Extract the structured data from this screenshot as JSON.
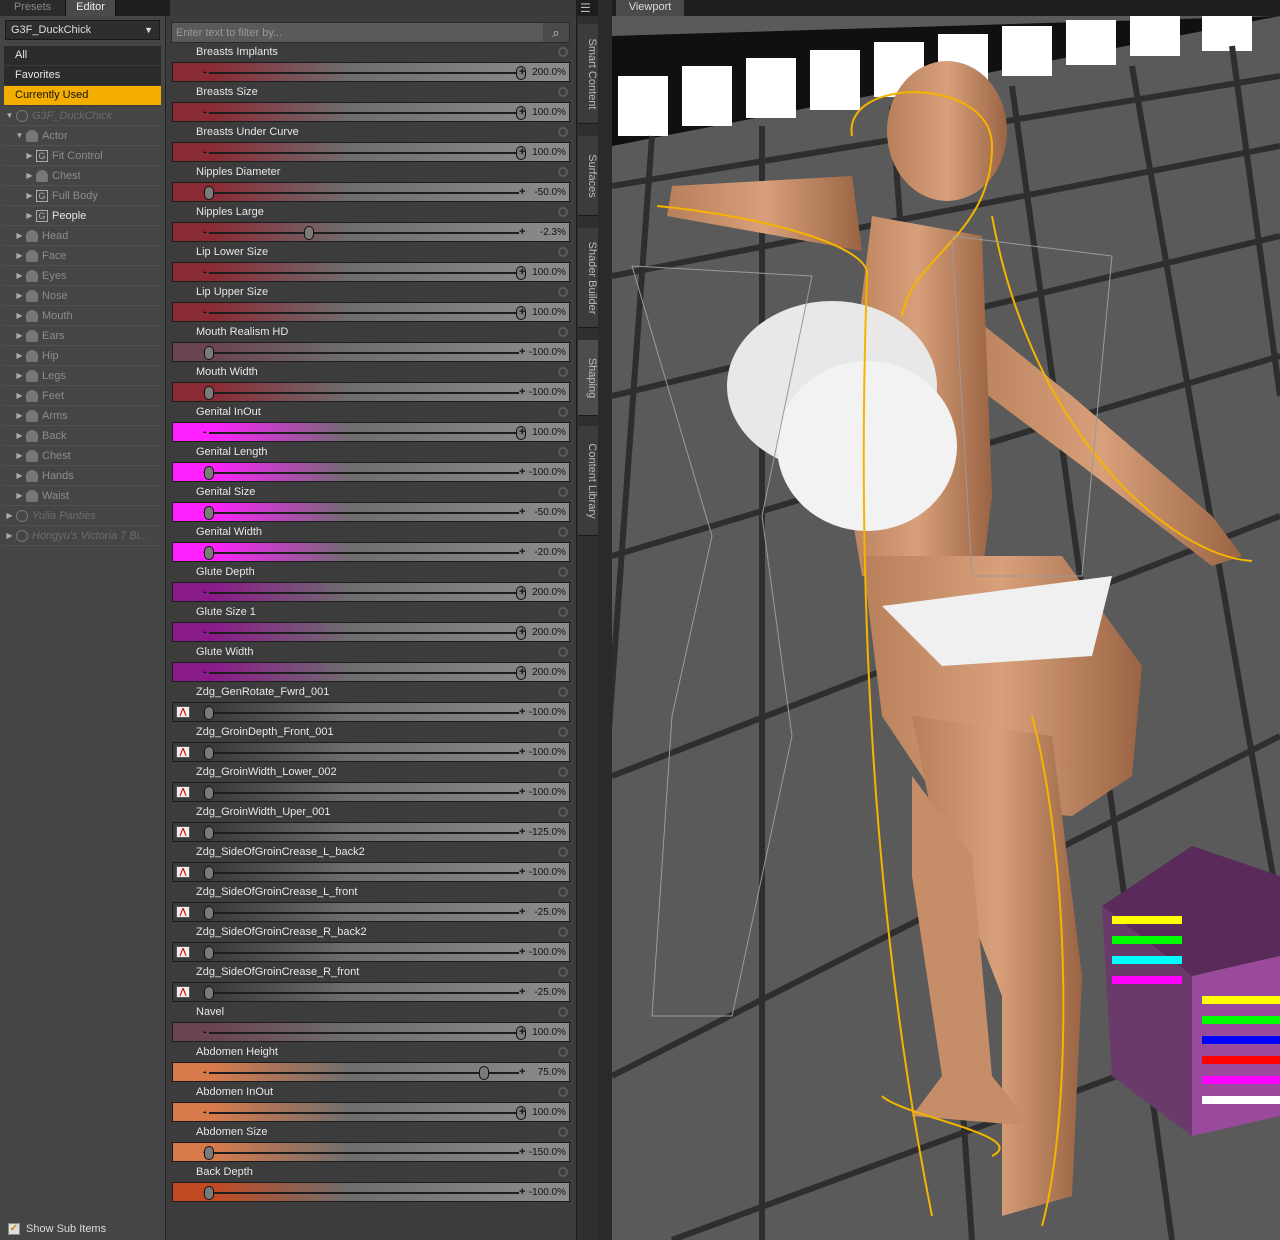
{
  "left_tabs": [
    "Presets",
    "Editor"
  ],
  "preset_select": {
    "value": "G3F_DuckChick"
  },
  "categories": [
    "All",
    "Favorites",
    "Currently Used"
  ],
  "tree": [
    {
      "label": "G3F_DuckChick",
      "level": 0,
      "icon": "figure",
      "style": "italic",
      "expand": "▼"
    },
    {
      "label": "Actor",
      "level": 1,
      "icon": "person",
      "style": "dim",
      "expand": "▼"
    },
    {
      "label": "Fit Control",
      "level": 2,
      "icon": "group",
      "style": "dim",
      "expand": "▶"
    },
    {
      "label": "Chest",
      "level": 2,
      "icon": "person",
      "style": "dim",
      "expand": "▶"
    },
    {
      "label": "Full Body",
      "level": 2,
      "icon": "group",
      "style": "dim",
      "expand": "▶"
    },
    {
      "label": "People",
      "level": 2,
      "icon": "group",
      "style": "hi",
      "expand": "▶"
    },
    {
      "label": "Head",
      "level": 1,
      "icon": "person",
      "style": "dim",
      "expand": "▶"
    },
    {
      "label": "Face",
      "level": 1,
      "icon": "person",
      "style": "dim",
      "expand": "▶"
    },
    {
      "label": "Eyes",
      "level": 1,
      "icon": "person",
      "style": "dim",
      "expand": "▶"
    },
    {
      "label": "Nose",
      "level": 1,
      "icon": "person",
      "style": "dim",
      "expand": "▶"
    },
    {
      "label": "Mouth",
      "level": 1,
      "icon": "person",
      "style": "dim",
      "expand": "▶"
    },
    {
      "label": "Ears",
      "level": 1,
      "icon": "person",
      "style": "dim",
      "expand": "▶"
    },
    {
      "label": "Hip",
      "level": 1,
      "icon": "person",
      "style": "dim",
      "expand": "▶"
    },
    {
      "label": "Legs",
      "level": 1,
      "icon": "person",
      "style": "dim",
      "expand": "▶"
    },
    {
      "label": "Feet",
      "level": 1,
      "icon": "person",
      "style": "dim",
      "expand": "▶"
    },
    {
      "label": "Arms",
      "level": 1,
      "icon": "person",
      "style": "dim",
      "expand": "▶"
    },
    {
      "label": "Back",
      "level": 1,
      "icon": "person",
      "style": "dim",
      "expand": "▶"
    },
    {
      "label": "Chest",
      "level": 1,
      "icon": "person",
      "style": "dim",
      "expand": "▶"
    },
    {
      "label": "Hands",
      "level": 1,
      "icon": "person",
      "style": "dim",
      "expand": "▶"
    },
    {
      "label": "Waist",
      "level": 1,
      "icon": "person",
      "style": "dim",
      "expand": "▶"
    },
    {
      "label": "Yulia Panties",
      "level": 0,
      "icon": "figure",
      "style": "italic",
      "expand": "▶"
    },
    {
      "label": "Hongyu's Victoria 7 Bi...",
      "level": 0,
      "icon": "figure",
      "style": "italic",
      "expand": "▶"
    }
  ],
  "show_sub_items": {
    "label": "Show Sub Items",
    "checked": true
  },
  "filter": {
    "placeholder": "Enter text to filter by..."
  },
  "properties": [
    {
      "name": "Breasts Implants",
      "value": "200.0%",
      "pos": 1.0,
      "color": "#8a2a35"
    },
    {
      "name": "Breasts Size",
      "value": "100.0%",
      "pos": 1.0,
      "color": "#8a2a35"
    },
    {
      "name": "Breasts Under Curve",
      "value": "100.0%",
      "pos": 1.0,
      "color": "#8a2a35"
    },
    {
      "name": "Nipples Diameter",
      "value": "-50.0%",
      "pos": 0.0,
      "color": "#8a2a35"
    },
    {
      "name": "Nipples Large",
      "value": "-2.3%",
      "pos": 0.32,
      "color": "#8a2a35"
    },
    {
      "name": "Lip Lower Size",
      "value": "100.0%",
      "pos": 1.0,
      "color": "#8a2a35"
    },
    {
      "name": "Lip Upper Size",
      "value": "100.0%",
      "pos": 1.0,
      "color": "#8a2a35"
    },
    {
      "name": "Mouth Realism HD",
      "value": "-100.0%",
      "pos": 0.0,
      "color": "#6a4550"
    },
    {
      "name": "Mouth Width",
      "value": "-100.0%",
      "pos": 0.0,
      "color": "#8a2a35"
    },
    {
      "name": "Genital InOut",
      "value": "100.0%",
      "pos": 1.0,
      "color": "#ff20ff"
    },
    {
      "name": "Genital Length",
      "value": "-100.0%",
      "pos": 0.0,
      "color": "#ff20ff"
    },
    {
      "name": "Genital Size",
      "value": "-50.0%",
      "pos": 0.0,
      "color": "#ff20ff"
    },
    {
      "name": "Genital Width",
      "value": "-20.0%",
      "pos": 0.0,
      "color": "#ff20ff"
    },
    {
      "name": "Glute Depth",
      "value": "200.0%",
      "pos": 1.0,
      "color": "#8a1a8a"
    },
    {
      "name": "Glute Size 1",
      "value": "200.0%",
      "pos": 1.0,
      "color": "#8a1a8a"
    },
    {
      "name": "Glute Width",
      "value": "200.0%",
      "pos": 1.0,
      "color": "#8a1a8a"
    },
    {
      "name": "Zdg_GenRotate_Fwrd_001",
      "value": "-100.0%",
      "pos": 0.0,
      "color": "#3a3a3a",
      "icon": true
    },
    {
      "name": "Zdg_GroinDepth_Front_001",
      "value": "-100.0%",
      "pos": 0.0,
      "color": "#3a3a3a",
      "icon": true
    },
    {
      "name": "Zdg_GroinWidth_Lower_002",
      "value": "-100.0%",
      "pos": 0.0,
      "color": "#3a3a3a",
      "icon": true
    },
    {
      "name": "Zdg_GroinWidth_Uper_001",
      "value": "-125.0%",
      "pos": 0.0,
      "color": "#3a3a3a",
      "icon": true
    },
    {
      "name": "Zdg_SideOfGroinCrease_L_back2",
      "value": "-100.0%",
      "pos": 0.0,
      "color": "#3a3a3a",
      "icon": true
    },
    {
      "name": "Zdg_SideOfGroinCrease_L_front",
      "value": "-25.0%",
      "pos": 0.0,
      "color": "#3a3a3a",
      "icon": true
    },
    {
      "name": "Zdg_SideOfGroinCrease_R_back2",
      "value": "-100.0%",
      "pos": 0.0,
      "color": "#3a3a3a",
      "icon": true
    },
    {
      "name": "Zdg_SideOfGroinCrease_R_front",
      "value": "-25.0%",
      "pos": 0.0,
      "color": "#3a3a3a",
      "icon": true
    },
    {
      "name": "Navel",
      "value": "100.0%",
      "pos": 1.0,
      "color": "#6a4550"
    },
    {
      "name": "Abdomen Height",
      "value": "75.0%",
      "pos": 0.88,
      "color": "#d77a4a"
    },
    {
      "name": "Abdomen InOut",
      "value": "100.0%",
      "pos": 1.0,
      "color": "#d77a4a"
    },
    {
      "name": "Abdomen Size",
      "value": "-150.0%",
      "pos": 0.0,
      "color": "#d77a4a"
    },
    {
      "name": "Back Depth",
      "value": "-100.0%",
      "pos": 0.0,
      "color": "#c24a22"
    }
  ],
  "side_tabs": [
    "Smart Content",
    "Surfaces",
    "Shader Builder",
    "Shaping",
    "Content Library"
  ],
  "viewport": {
    "tab": "Viewport",
    "menu_icon": "hamburger-icon"
  }
}
